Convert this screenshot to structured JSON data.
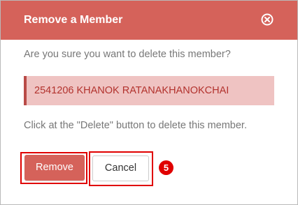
{
  "dialog": {
    "title": "Remove a Member",
    "close_icon": "close-circle-icon",
    "question": "Are you sure you want to delete this member?",
    "member": "2541206 KHANOK RATANAKHANOKCHAI",
    "instruction": "Click at the \"Delete\" button to delete this member.",
    "remove_label": "Remove",
    "cancel_label": "Cancel"
  },
  "annotation": {
    "step_number": "5"
  },
  "colors": {
    "header": "#d5625a",
    "remove_button": "#d5625a",
    "member_box_bg": "#efc3c2",
    "member_box_border": "#b94b47",
    "member_text": "#b2322d",
    "highlight": "#e00000"
  }
}
